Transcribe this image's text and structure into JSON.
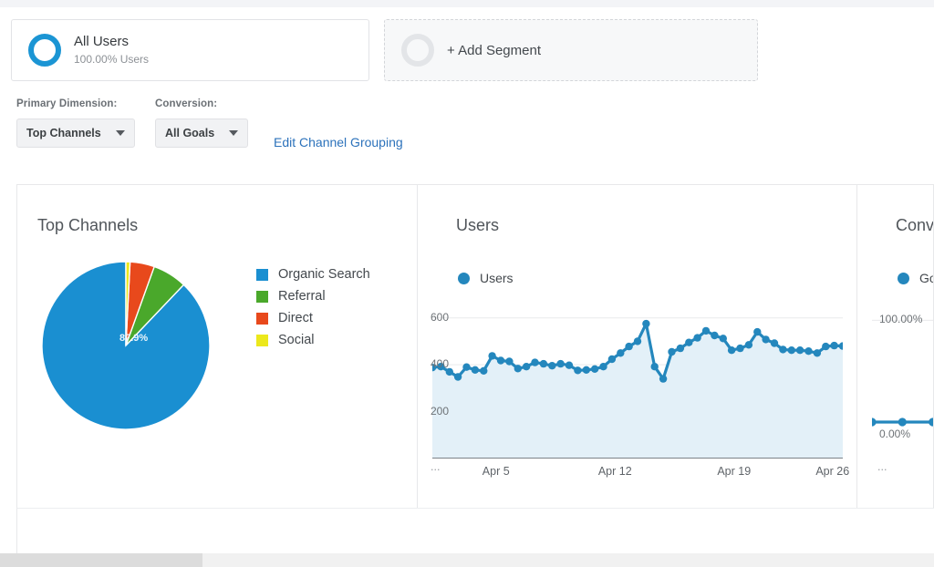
{
  "segments": {
    "all_users": {
      "title": "All Users",
      "subtitle": "100.00% Users",
      "icon": "ring-icon"
    },
    "add_segment": {
      "label": "+ Add Segment",
      "icon": "ring-outline-icon"
    }
  },
  "controls": {
    "primary_dimension_label": "Primary Dimension:",
    "primary_dimension_value": "Top Channels",
    "conversion_label": "Conversion:",
    "conversion_value": "All Goals",
    "edit_link": "Edit Channel Grouping"
  },
  "panels": {
    "pie": {
      "title": "Top Channels"
    },
    "users": {
      "title": "Users"
    },
    "conversions": {
      "title": "Conv"
    }
  },
  "colors": {
    "organic": "#1a8fd1",
    "referral": "#4aa82b",
    "direct": "#e8491c",
    "social": "#ece81c",
    "line": "#2487bd",
    "area": "#e3f0f8",
    "link": "#2c72bb"
  },
  "chart_data": [
    {
      "type": "pie",
      "title": "Top Channels",
      "legend_position": "right",
      "labels": [
        "Organic Search",
        "Referral",
        "Direct",
        "Social"
      ],
      "values": [
        87.9,
        6.6,
        4.7,
        0.8
      ],
      "colors": [
        "#1a8fd1",
        "#4aa82b",
        "#e8491c",
        "#ece81c"
      ],
      "data_labels": [
        "87.9%"
      ],
      "start_angle_deg": 0,
      "direction": "counterclockwise"
    },
    {
      "type": "area",
      "title": "Users",
      "series": [
        {
          "name": "Users",
          "values": [
            388,
            392,
            370,
            348,
            390,
            378,
            374,
            438,
            418,
            414,
            384,
            392,
            410,
            404,
            396,
            404,
            398,
            376,
            378,
            382,
            392,
            424,
            450,
            478,
            500,
            575,
            392,
            340,
            455,
            470,
            495,
            515,
            545,
            525,
            512,
            462,
            470,
            485,
            540,
            508,
            492,
            465,
            462,
            462,
            458,
            450,
            478,
            482,
            480
          ]
        }
      ],
      "xlabel": "",
      "ylabel": "",
      "ylim": [
        0,
        700
      ],
      "yticks": [
        200,
        400,
        600
      ],
      "ytick_labels": [
        "200",
        "400",
        "600"
      ],
      "xticks": [
        "Apr 5",
        "Apr 12",
        "Apr 19",
        "Apr 26"
      ],
      "xtick_leading": "...",
      "legend": [
        "Users"
      ],
      "legend_position": "top-left",
      "grid": true
    },
    {
      "type": "line",
      "title": "Conv",
      "series": [
        {
          "name": "Go",
          "values": [
            0,
            0,
            0,
            0,
            0,
            0,
            0
          ]
        }
      ],
      "ylim": [
        0,
        100
      ],
      "yticks": [
        0,
        100
      ],
      "ytick_labels": [
        "0.00%",
        "100.00%"
      ],
      "xtick_leading": "...",
      "legend": [
        "Go"
      ],
      "legend_position": "top-left",
      "grid": true
    }
  ]
}
